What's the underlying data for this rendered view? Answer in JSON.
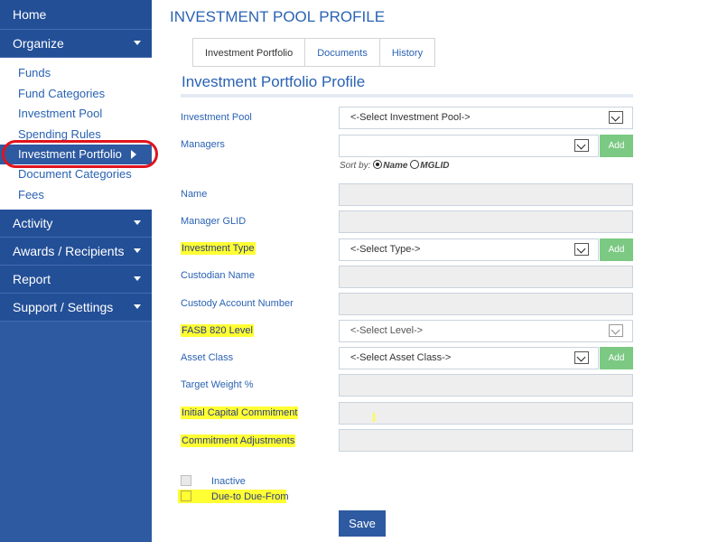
{
  "sidebar": {
    "home": "Home",
    "organize": "Organize",
    "organize_items": [
      "Funds",
      "Fund Categories",
      "Investment Pool",
      "Spending Rules",
      "Investment Portfolio",
      "Document Categories",
      "Fees"
    ],
    "activity": "Activity",
    "awards": "Awards / Recipients",
    "report": "Report",
    "support": "Support / Settings"
  },
  "header": {
    "title": "INVESTMENT POOL PROFILE"
  },
  "tabs": [
    "Investment Portfolio",
    "Documents",
    "History"
  ],
  "section": {
    "title": "Investment Portfolio Profile"
  },
  "form": {
    "investment_pool": {
      "label": "Investment Pool",
      "value": "<-Select Investment Pool->"
    },
    "managers": {
      "label": "Managers",
      "value": "",
      "add": "Add"
    },
    "sort_by": {
      "label": "Sort by:",
      "option1": "Name",
      "option2": "MGLID",
      "selected": "Name"
    },
    "name": {
      "label": "Name"
    },
    "manager_glid": {
      "label": "Manager GLID"
    },
    "investment_type": {
      "label": "Investment Type",
      "value": "<-Select Type->",
      "add": "Add"
    },
    "custodian_name": {
      "label": "Custodian Name"
    },
    "custody_account_number": {
      "label": "Custody Account Number"
    },
    "fasb_level": {
      "label": "FASB 820 Level",
      "value": "<-Select Level->"
    },
    "asset_class": {
      "label": "Asset Class",
      "value": "<-Select Asset Class->",
      "add": "Add"
    },
    "target_weight": {
      "label": "Target Weight %"
    },
    "initial_capital_commitment": {
      "label": "Initial Capital Commitment"
    },
    "commitment_adjustments": {
      "label": "Commitment Adjustments"
    },
    "inactive": {
      "label": "Inactive"
    },
    "due_to_due_from": {
      "label": "Due-to Due-From"
    },
    "save": "Save"
  },
  "colors": {
    "nav_bg": "#2e5aa1",
    "accent": "#2a62b3",
    "add_green": "#7bc983",
    "highlight": "#ffff33",
    "ring_red": "#e0141e"
  }
}
